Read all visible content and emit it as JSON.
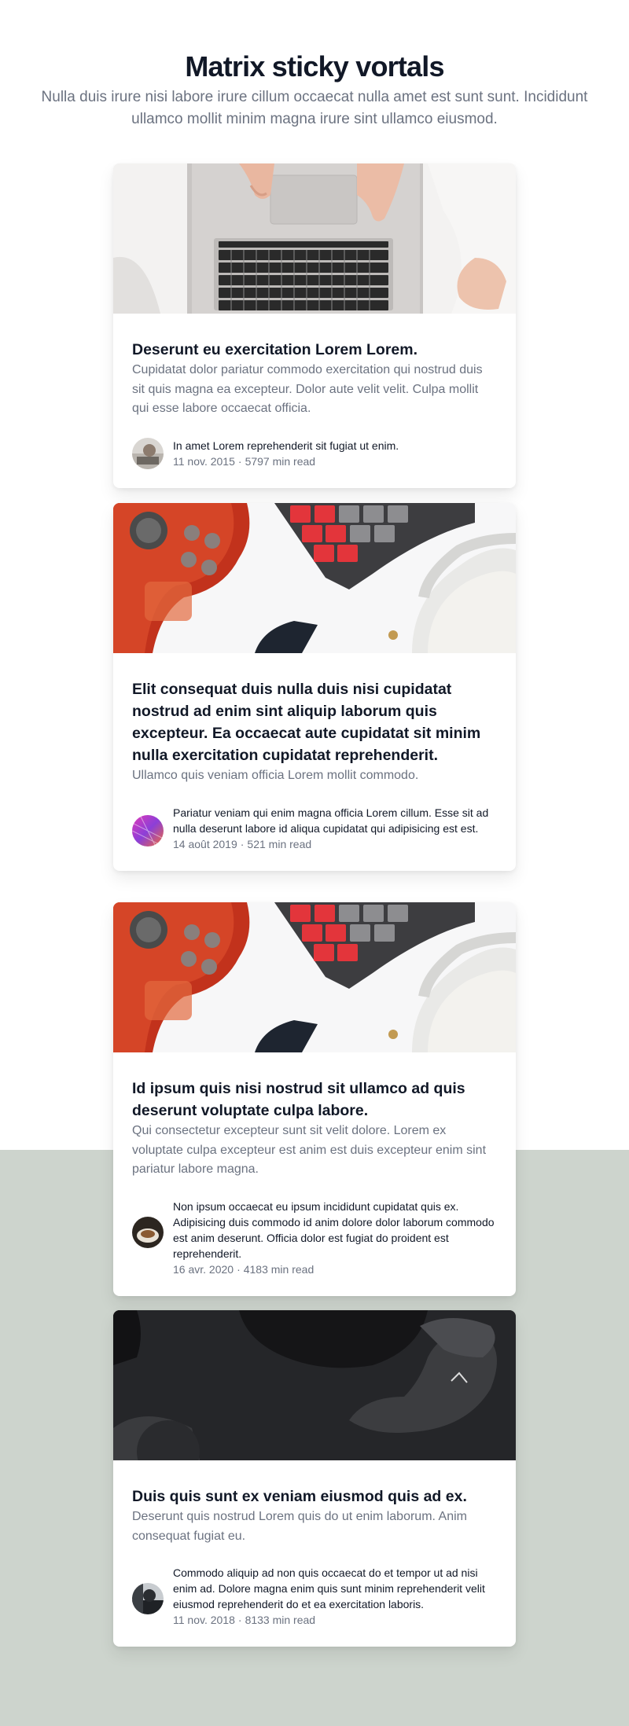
{
  "header": {
    "title": "Matrix sticky vortals",
    "subtitle": "Nulla duis irure nisi labore irure cillum occaecat nulla amet est sunt sunt. Incididunt ullamco mollit minim magna irure sint ullamco eiusmod."
  },
  "posts": [
    {
      "image_icon": "laptop-photo",
      "title": "Deserunt eu exercitation Lorem Lorem.",
      "description": "Cupidatat dolor pariatur commodo exercitation qui nostrud duis sit quis magna ea excepteur. Dolor aute velit velit. Culpa mollit qui esse labore occaecat officia.",
      "author": "In amet Lorem reprehenderit sit fugiat ut enim.",
      "date": "11 nov. 2015",
      "separator": "·",
      "read_time": "5797 min read"
    },
    {
      "image_icon": "gamepad-keyboard-photo",
      "title": "Elit consequat duis nulla duis nisi cupidatat nostrud ad enim sint aliquip laborum quis excepteur. Ea occaecat aute cupidatat sit minim nulla exercitation cupidatat reprehenderit.",
      "description": "Ullamco quis veniam officia Lorem mollit commodo.",
      "author": "Pariatur veniam qui enim magna officia Lorem cillum. Esse sit ad nulla deserunt labore id aliqua cupidatat qui adipisicing est est.",
      "date": "14 août 2019",
      "separator": "·",
      "read_time": "521 min read"
    },
    {
      "image_icon": "gamepad-keyboard-photo",
      "title": "Id ipsum quis nisi nostrud sit ullamco ad quis deserunt voluptate culpa labore.",
      "description": "Qui consectetur excepteur sunt sit velit dolore. Lorem ex voluptate culpa excepteur est anim est duis excepteur enim sint pariatur labore magna.",
      "author": "Non ipsum occaecat eu ipsum incididunt cupidatat quis ex. Adipisicing duis commodo id anim dolore dolor laborum commodo est anim deserunt. Officia dolor est fugiat do proident est reprehenderit.",
      "date": "16 avr. 2020",
      "separator": "·",
      "read_time": "4183 min read"
    },
    {
      "image_icon": "dark-gear-photo",
      "title": "Duis quis sunt ex veniam eiusmod quis ad ex.",
      "description": "Deserunt quis nostrud Lorem quis do ut enim laborum. Anim consequat fugiat eu.",
      "author": "Commodo aliquip ad non quis occaecat do et tempor ut ad nisi enim ad. Dolore magna enim quis sunt minim reprehenderit velit eiusmod reprehenderit do et ea exercitation laboris.",
      "date": "11 nov. 2018",
      "separator": "·",
      "read_time": "8133 min read"
    }
  ]
}
